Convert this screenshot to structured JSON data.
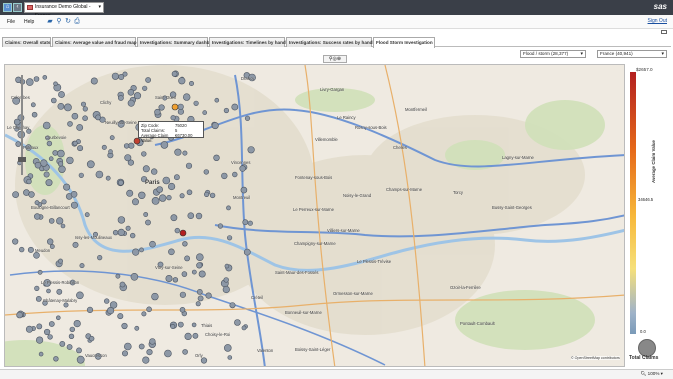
{
  "app": {
    "report_title": "Insurance Demo Global - France",
    "logo": "sas",
    "sign_out": "Sign Out"
  },
  "menu": {
    "file": "File",
    "help": "Help"
  },
  "tabs": [
    {
      "label": "Claims: Overall stats"
    },
    {
      "label": "Claims: Average value and fraud map"
    },
    {
      "label": "Investigations: Summary dashboard"
    },
    {
      "label": "Investigations: Timelines by handler"
    },
    {
      "label": "Investigations: Success rates by handler"
    },
    {
      "label": "Flood Storm Investigation"
    }
  ],
  "filters": {
    "peril": "Flood / storm (28,377)",
    "country": "France (40,941)"
  },
  "map": {
    "places": [
      "Drancy",
      "Livry-Gargan",
      "Colombes",
      "Clichy",
      "Saint-Ouen",
      "Le Raincy",
      "Montfermeil",
      "Rosny-sous-Bois",
      "Le Chesnay",
      "Neuilly-sur-Seine",
      "Villemomble",
      "Courbevoie",
      "Puteaux",
      "Chelles",
      "Vincennes",
      "Torcy",
      "Paris",
      "Noisy-le-Grand",
      "Lagny-sur-Marne",
      "Champs-sur-Marne",
      "Fontenay-sous-Bois",
      "Montreuil",
      "Bussy-Saint-Georges",
      "Boulogne-Billancourt",
      "Le Perreux-sur-Marne",
      "Villiers-sur-Marne",
      "Meudon",
      "Issy-les-Moulineaux",
      "Champigny-sur-Marne",
      "Vitry-sur-Seine",
      "Créteil",
      "Le Plessis-Trévise",
      "Saint-Maur-des-Fossés",
      "Ormesson-sur-Marne",
      "Ozoir-la-Ferrière",
      "Châtenay-Malabry",
      "Thiais",
      "Choisy-le-Roi",
      "Orly",
      "Valenton",
      "Boissy-Saint-Léger",
      "Bonneuil-sur-Marne",
      "Le Plessis-Robinson",
      "Pontault-Combault",
      "Vaucresson",
      "Vélizy-Villacoublay",
      "Verrières-le-Buisson",
      "Sucy-en-Brie",
      "Lognes",
      "Noisiel",
      "Montévrain",
      "Romainville",
      "Bagnolet",
      "Gournay-sur-Marne",
      "Chennevières-sur-Marne",
      "Émerainville",
      "Roissy-en-Brie",
      "Clamart",
      "Massy"
    ],
    "attribution": "© OpenStreetMap contributors",
    "tooltip": {
      "k1": "Zip Code:",
      "v1": "75020",
      "k2": "Total Claims:",
      "v2": "5",
      "k3": "Average Claim Value:",
      "v3": "€6730.00"
    }
  },
  "legend": {
    "max": "$2657.0",
    "mid": "34646.5",
    "min": "0.0",
    "axis_label": "Average Claim Value",
    "size_label": "Total Claims",
    "color_max": "#b32020",
    "color_min": "#7a9ab8"
  },
  "status": {
    "zoom": "100%"
  }
}
